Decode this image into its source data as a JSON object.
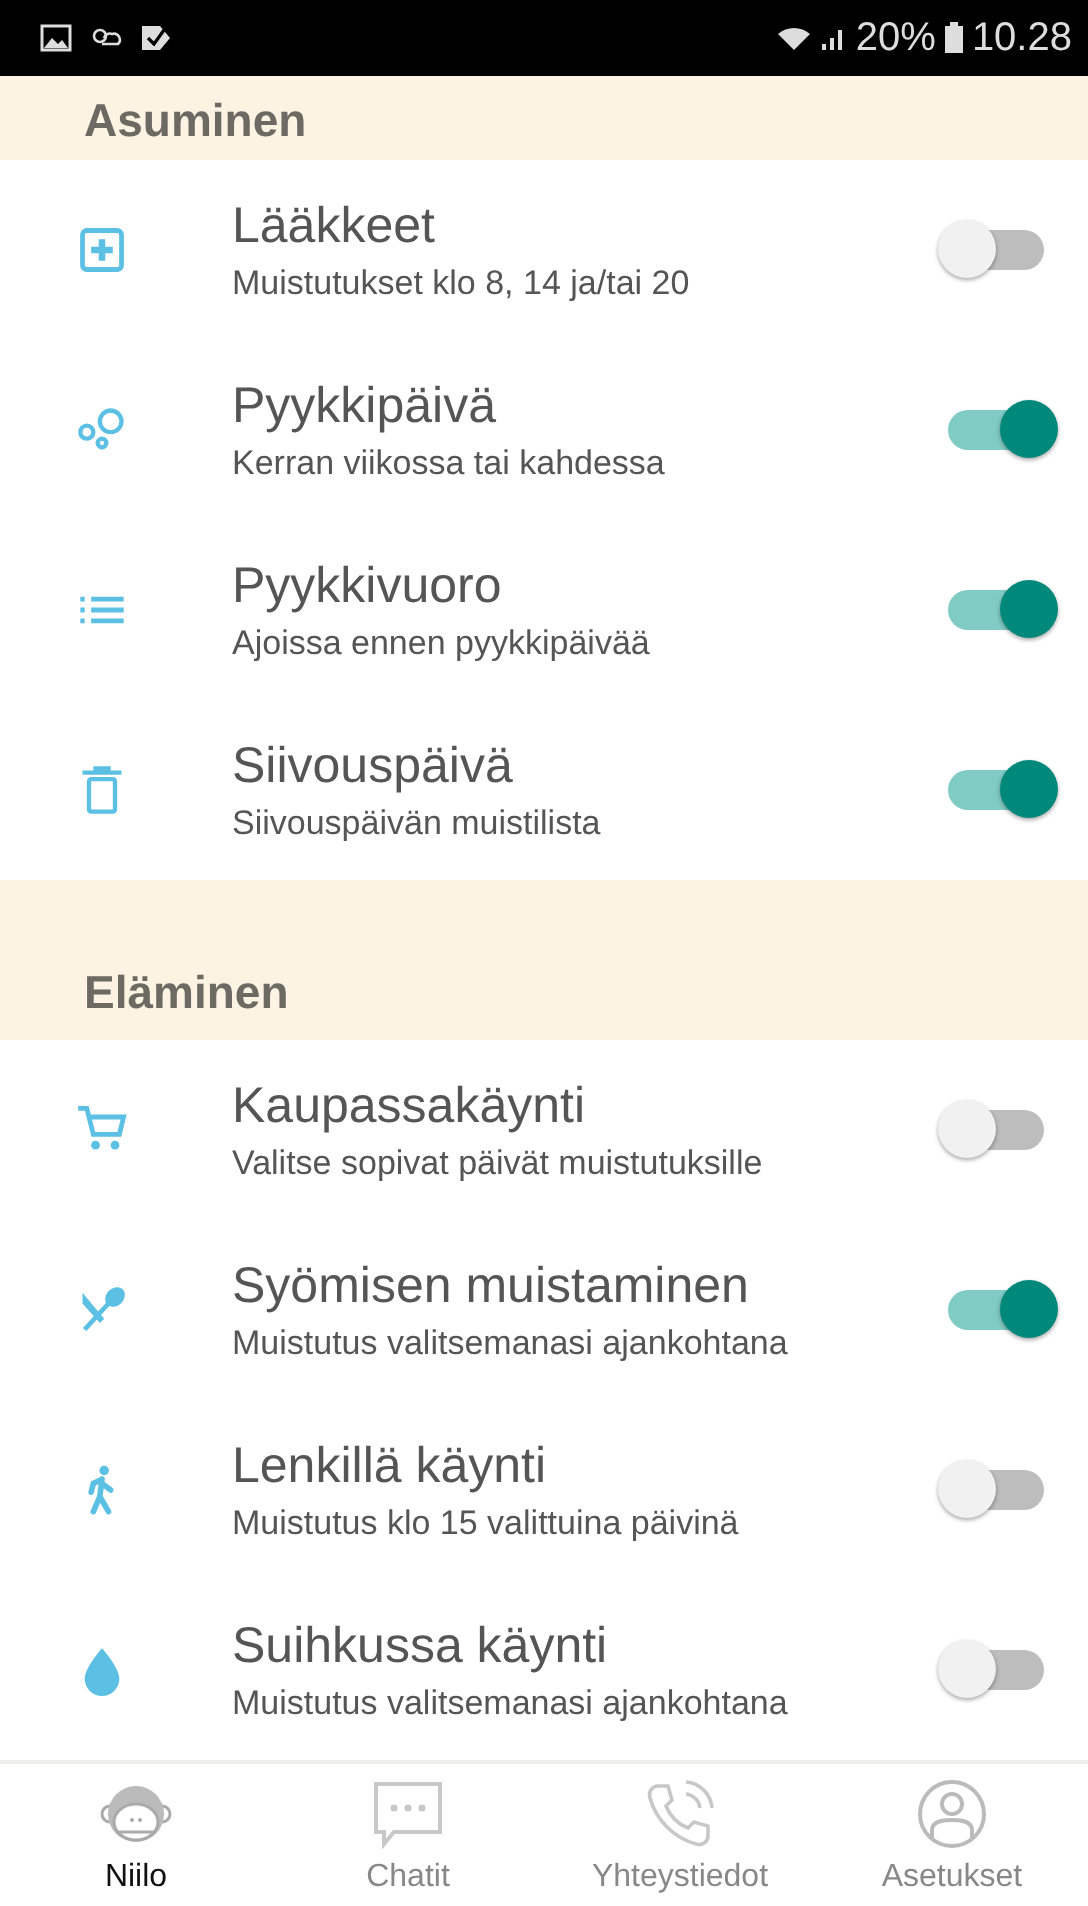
{
  "status_bar": {
    "battery": "20%",
    "time": "10.28"
  },
  "sections": [
    {
      "title": "Asuminen",
      "items": [
        {
          "title": "Lääkkeet",
          "subtitle": "Muistutukset klo 8, 14 ja/tai 20",
          "on": false
        },
        {
          "title": "Pyykkipäivä",
          "subtitle": "Kerran viikossa tai kahdessa",
          "on": true
        },
        {
          "title": "Pyykkivuoro",
          "subtitle": "Ajoissa ennen pyykkipäivää",
          "on": true
        },
        {
          "title": "Siivouspäivä",
          "subtitle": "Siivouspäivän muistilista",
          "on": true
        }
      ]
    },
    {
      "title": "Eläminen",
      "items": [
        {
          "title": "Kaupassakäynti",
          "subtitle": "Valitse sopivat päivät muistutuksille",
          "on": false
        },
        {
          "title": "Syömisen muistaminen",
          "subtitle": "Muistutus valitsemanasi ajankohtana",
          "on": true
        },
        {
          "title": "Lenkillä käynti",
          "subtitle": "Muistutus klo 15 valittuina päivinä",
          "on": false
        },
        {
          "title": "Suihkussa käynti",
          "subtitle": "Muistutus valitsemanasi ajankohtana",
          "on": false
        }
      ]
    }
  ],
  "bottom_nav": [
    {
      "label": "Niilo",
      "selected": true
    },
    {
      "label": "Chatit",
      "selected": false
    },
    {
      "label": "Yhteystiedot",
      "selected": false
    },
    {
      "label": "Asetukset",
      "selected": false
    }
  ]
}
